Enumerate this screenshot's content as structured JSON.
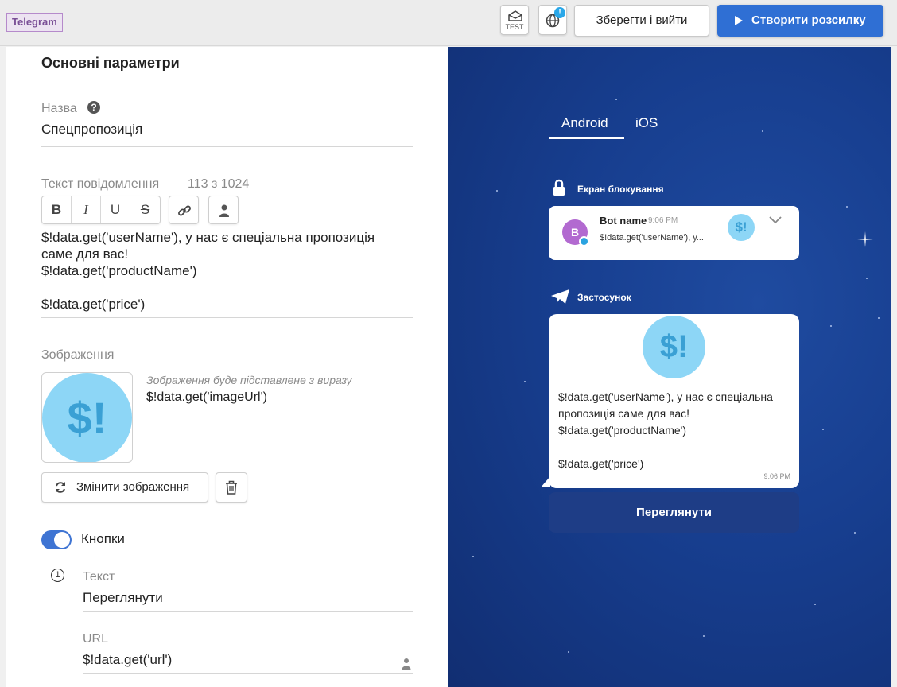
{
  "topbar": {
    "channel": "Telegram",
    "test_label": "TEST",
    "globe_alert": "!",
    "save_exit": "Зберегти і вийти",
    "create": "Створити розсилку"
  },
  "form": {
    "section_title": "Основні параметри",
    "name_label": "Назва",
    "help_icon": "?",
    "name_value": "Спецпропозиція",
    "text_label": "Текст повідомлення",
    "counter": "113 з 1024",
    "format_buttons": [
      "B",
      "I",
      "U",
      "S"
    ],
    "message_lines": [
      "$!data.get('userName'), у нас є спеціальна пропозиція",
      "саме для вас!",
      "$!data.get('productName')",
      "",
      "$!data.get('price')"
    ],
    "image_label": "Зображення",
    "image_placeholder": "$!",
    "image_hint": "Зображення буде підставлене з виразу",
    "image_expr": "$!data.get('imageUrl')",
    "change_image": "Змінити зображення",
    "buttons_toggle_label": "Кнопки",
    "buttons_toggle_on": true,
    "button_index": "1",
    "button_text_label": "Текст",
    "button_text_value": "Переглянути",
    "url_label": "URL",
    "url_value": "$!data.get('url')"
  },
  "preview": {
    "tabs": [
      "Android",
      "iOS"
    ],
    "active_tab": "Android",
    "lock_screen_label": "Екран блокування",
    "bot_avatar": "B",
    "bot_name": "Bot name",
    "bot_time": "9:06 PM",
    "bot_preview": "$!data.get('userName'), у...",
    "bot_image": "$!",
    "app_label": "Застосунок",
    "app_image": "$!",
    "app_lines": [
      "$!data.get('userName'), у нас є спеціальна",
      "пропозиція саме для вас!",
      "$!data.get('productName')",
      "",
      "$!data.get('price')"
    ],
    "app_time": "9:06 PM",
    "app_button": "Переглянути"
  },
  "colors": {
    "primary": "#2f6fd4",
    "preview_bg": "#173e8f",
    "accent_light": "#8dd6f6",
    "telegram_badge": "#7a4f96"
  },
  "icons": {
    "test": "envelope-test-icon",
    "globe": "globe-icon",
    "help": "question-circle-icon",
    "link": "link-icon",
    "person": "person-icon",
    "refresh": "refresh-icon",
    "trash": "trash-icon",
    "lock": "lock-icon",
    "telegram": "telegram-plane-icon",
    "chevron": "chevron-down-icon"
  }
}
